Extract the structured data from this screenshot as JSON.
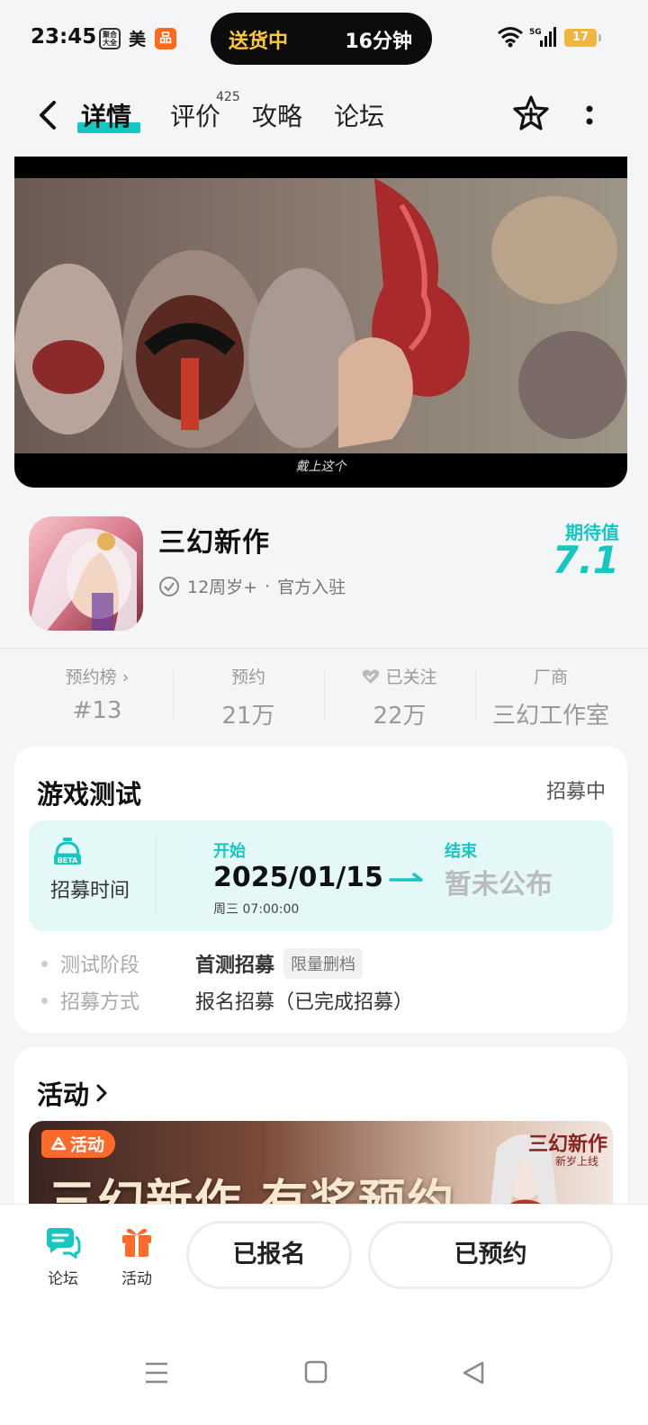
{
  "status_bar": {
    "time": "23:45",
    "app_icon_1_text": "聚合大全",
    "app_icon_2_text": "美",
    "app_icon_3_text": "品",
    "delivery_status": "送货中",
    "delivery_eta": "16分钟",
    "network": "5G",
    "battery": "17"
  },
  "nav": {
    "tabs": [
      {
        "label": "详情",
        "active": true
      },
      {
        "label": "评价",
        "badge": "425"
      },
      {
        "label": "攻略"
      },
      {
        "label": "论坛"
      }
    ]
  },
  "video": {
    "caption": "戴上这个"
  },
  "game": {
    "title": "三幻新作",
    "age_rating": "12周岁+",
    "separator": "·",
    "official": "官方入驻",
    "expect_label": "期待值",
    "expect_value": "7.1"
  },
  "stats": [
    {
      "label": "预约榜 ›",
      "value": "#13"
    },
    {
      "label": "预约",
      "value": "21万"
    },
    {
      "label": "已关注",
      "value": "22万"
    },
    {
      "label": "厂商",
      "value": "三幻工作室"
    }
  ],
  "test_card": {
    "title": "游戏测试",
    "status": "招募中",
    "time_label": "招募时间",
    "start_label": "开始",
    "start_date": "2025/01/15",
    "start_day": "周三  07:00:00",
    "end_label": "结束",
    "end_value": "暂未公布",
    "rows": [
      {
        "key": "测试阶段",
        "value": "首测招募",
        "tag": "限量删档"
      },
      {
        "key": "招募方式",
        "value": "报名招募（已完成招募）"
      }
    ]
  },
  "activity_card": {
    "title": "活动",
    "banner_tag": "活动",
    "banner_headline": "三幻新作 有奖预约",
    "banner_logo": "三幻新作",
    "banner_sub": "新岁上线"
  },
  "bottom_bar": {
    "forum_label": "论坛",
    "activity_label": "活动",
    "signed_up_label": "已报名",
    "reserved_label": "已预约"
  },
  "colors": {
    "accent": "#16c6c1",
    "activity_orange": "#ff6a2b",
    "delivery_yellow": "#ffc93a"
  }
}
